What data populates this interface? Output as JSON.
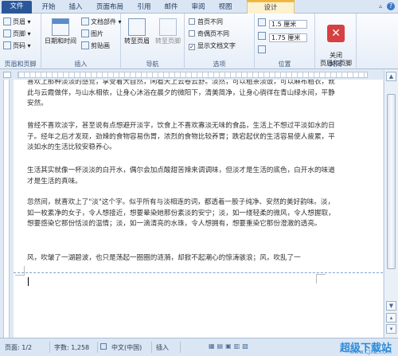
{
  "tabs": {
    "file": "文件",
    "items": [
      "开始",
      "插入",
      "页面布局",
      "引用",
      "邮件",
      "审阅",
      "视图"
    ],
    "design": "设计"
  },
  "ribbon": {
    "header_footer": {
      "header": "页眉",
      "footer": "页脚",
      "page_number": "页码",
      "label": "页眉和页脚"
    },
    "insert": {
      "datetime": "日期和时间",
      "doc_parts": "文档部件",
      "picture": "图片",
      "clipart": "剪贴画",
      "label": "插入"
    },
    "nav": {
      "goto_header": "转至页眉",
      "goto_footer": "转至页脚",
      "label": "导航"
    },
    "options": {
      "first_page": "首页不同",
      "odd_even": "奇偶页不同",
      "show_text": "显示文档文字",
      "label": "选项"
    },
    "position": {
      "header_pos": "1.5 厘米",
      "footer_pos": "1.75 厘米",
      "label": "位置"
    },
    "close": {
      "button": "关闭\n页眉和页脚",
      "label": "关闭"
    }
  },
  "document": {
    "paragraphs": [
      "喜欢上那种淡淡的感觉，享受着大自然，闲看天上云卷云舒。淡然，可以粗茶淡饭，可以麻布粗衣，就此与云霞做伴，与山水相依，让身心沐浴在晨夕的微阳下，清美简净，让身心徜徉在青山绿水间，平静安然。",
      "曾经不喜欢淡字，甚至说有点想避开淡字，饮食上不喜欢寡淡无味的食品，生活上不想过平淡如水的日子。经年之后才发现，劲辣的食物容易伤胃，浓烈的食物比较养胃；跌宕起伏的生活容易使人疲累，平淡如水的生活比较安稳养心。",
      "生活其实就像一杯淡淡的白开水，偶尔会加点酸甜苦辣来调调味，但淡才是生活的底色，白开水的味道才是生活的真味。",
      "忽然间，就喜欢上了\"淡\"这个字。似乎所有与淡相连的词，都透着一股子纯净、安然的美好韵味。淡，如一枚素净的女子，令人想接近，想要晕染她那份素淡的安宁；淡，如一缕轻柔的微风，令人想握取，想要感染它那份恬淡的温情；淡，如一滴清亮的水珠，令人想拥有，想要重染它那份澄澈的透亮。",
      "风，吹皱了一湖碧波，也只是荡起一圈圈的涟漪，却掀不起潮心的惊涛骇浪；风，吹乱了一"
    ]
  },
  "status": {
    "page": "页面: 1/2",
    "words": "字数: 1,258",
    "language": "中文(中国)",
    "mode": "插入"
  },
  "watermark": {
    "title": "超级下载站",
    "url": "www.CJXZ.com"
  }
}
